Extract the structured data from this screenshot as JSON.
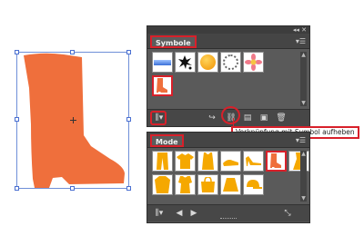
{
  "symbols_panel": {
    "title": "Symbole",
    "selected_symbol": "boot",
    "thumbnails": [
      "blue-gradient-bar",
      "ink-splash",
      "orange-orb",
      "dotted-ring",
      "pink-flower",
      "boot"
    ]
  },
  "mode_panel": {
    "title": "Mode",
    "thumbnails": [
      "pants",
      "shirt",
      "tank-top",
      "sandals",
      "heels",
      "boot",
      "dress",
      "coat",
      "tote-bag",
      "skirt",
      "cap"
    ]
  },
  "tooltip": {
    "text": "Verknüpfung mit Symbol aufheben"
  },
  "colors": {
    "accent": "#d8202a",
    "boot": "#ef6f3c",
    "icon_orange": "#f5a800"
  }
}
